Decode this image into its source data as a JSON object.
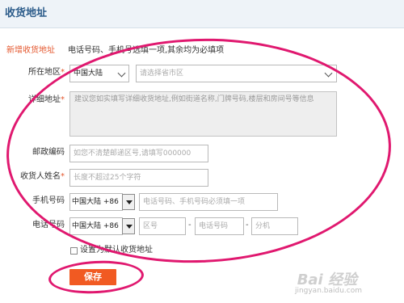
{
  "header": {
    "title": "收货地址"
  },
  "notice": {
    "link_label": "新增收货地址",
    "text": "电话号码、手机号选填一项,其余均为必填项"
  },
  "form": {
    "region": {
      "label": "所在地区",
      "required_mark": "*",
      "country_value": "中国大陆",
      "placeholder": "请选择省市区"
    },
    "detail": {
      "label": "详细地址",
      "required_mark": "*",
      "placeholder": "建议您如实填写详细收货地址,例如街道名称,门牌号码,楼层和房间号等信息"
    },
    "postcode": {
      "label": "邮政编码",
      "placeholder": "如您不清楚邮递区号,请填写000000"
    },
    "name": {
      "label": "收货人姓名",
      "required_mark": "*",
      "placeholder": "长度不超过25个字符"
    },
    "mobile": {
      "label": "手机号码",
      "country_code": "中国大陆 +86",
      "placeholder": "电话号码、手机号码必须填一项"
    },
    "phone": {
      "label": "电话号码",
      "country_code": "中国大陆 +86",
      "area_placeholder": "区号",
      "number_placeholder": "电话号码",
      "ext_placeholder": "分机",
      "separator": "-"
    },
    "default_checkbox": {
      "label": "设置为默认收货地址",
      "checked": false
    },
    "save_label": "保存"
  },
  "watermark": {
    "logo": "Bai 经验",
    "url": "jingyan.baidu.com"
  },
  "colors": {
    "accent": "#f15a22",
    "annotation": "#e0186f",
    "title": "#2b5b8a"
  }
}
